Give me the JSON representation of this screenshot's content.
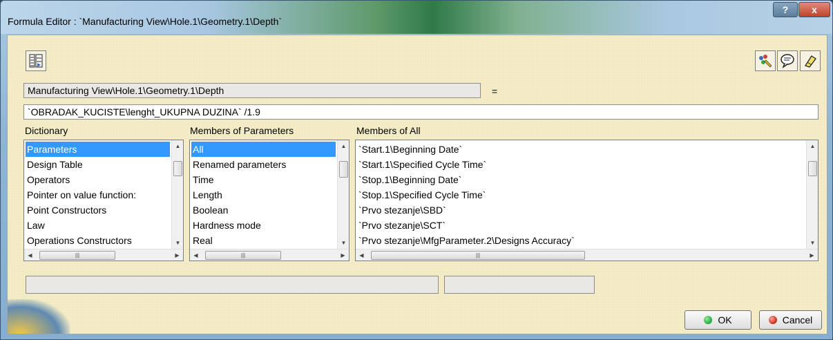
{
  "window": {
    "title": "Formula Editor : `Manufacturing View\\Hole.1\\Geometry.1\\Depth`",
    "help_label": "?",
    "close_label": "x"
  },
  "parameter": {
    "name": "Manufacturing View\\Hole.1\\Geometry.1\\Depth",
    "equals": "="
  },
  "formula": {
    "value": "`OBRADAK_KUCISTE\\lenght_UKUPNA DUZINA` /1.9"
  },
  "dictionary": {
    "label": "Dictionary",
    "items": [
      "Parameters",
      "Design Table",
      "Operators",
      "Pointer on value function:",
      "Point Constructors",
      "Law",
      "Operations Constructors"
    ],
    "selected": "Parameters"
  },
  "members_of_parameters": {
    "label": "Members of Parameters",
    "items": [
      "All",
      "Renamed parameters",
      "Time",
      "Length",
      "Boolean",
      "Hardness mode",
      "Real"
    ],
    "selected": "All"
  },
  "members_of_all": {
    "label": "Members of All",
    "items": [
      "`Start.1\\Beginning Date`",
      "`Start.1\\Specified Cycle Time`",
      "`Stop.1\\Beginning Date`",
      "`Stop.1\\Specified Cycle Time`",
      "`Prvo stezanje\\SBD`",
      "`Prvo stezanje\\SCT`",
      "`Prvo stezanje\\MfgParameter.2\\Designs Accuracy`"
    ]
  },
  "buttons": {
    "ok": "OK",
    "cancel": "Cancel"
  },
  "colors": {
    "selection": "#3399ff",
    "ok_dot": "#2db24a",
    "cancel_dot": "#d43a2a"
  }
}
